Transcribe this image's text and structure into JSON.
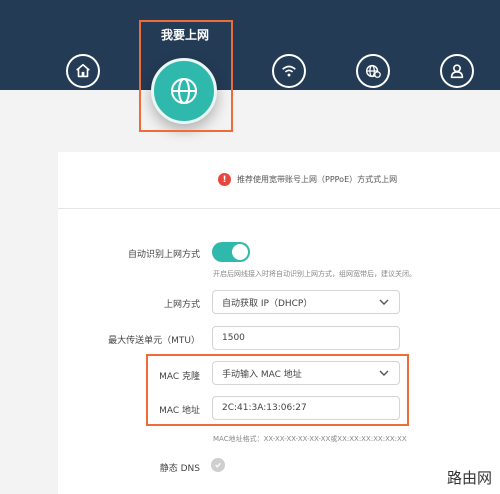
{
  "nav": {
    "active_title": "我要上网",
    "icons": [
      "home-icon",
      "globe-icon",
      "wifi-icon",
      "network-settings-icon",
      "user-icon"
    ]
  },
  "notice": {
    "text": "推荐使用宽带账号上网（PPPoE）方式式上网"
  },
  "form": {
    "auto_detect_label": "自动识别上网方式",
    "auto_detect_hint": "开启后网线接入时将自动识别上网方式，组网宽带后，建议关闭。",
    "connection_label": "上网方式",
    "connection_value": "自动获取 IP（DHCP）",
    "mtu_label": "最大传送单元（MTU）",
    "mtu_value": "1500",
    "mac_clone_label": "MAC 克隆",
    "mac_clone_value": "手动输入 MAC 地址",
    "mac_addr_label": "MAC 地址",
    "mac_addr_value": "2C:41:3A:13:06:27",
    "mac_format_hint": "MAC地址格式：XX-XX-XX-XX-XX-XX或XX:XX:XX:XX:XX:XX",
    "static_dns_label": "静态 DNS"
  },
  "watermark": "路由网",
  "colors": {
    "topbar": "#243b55",
    "accent": "#2fb9ad",
    "highlight": "#ef6c3a",
    "warning": "#e8453c"
  }
}
